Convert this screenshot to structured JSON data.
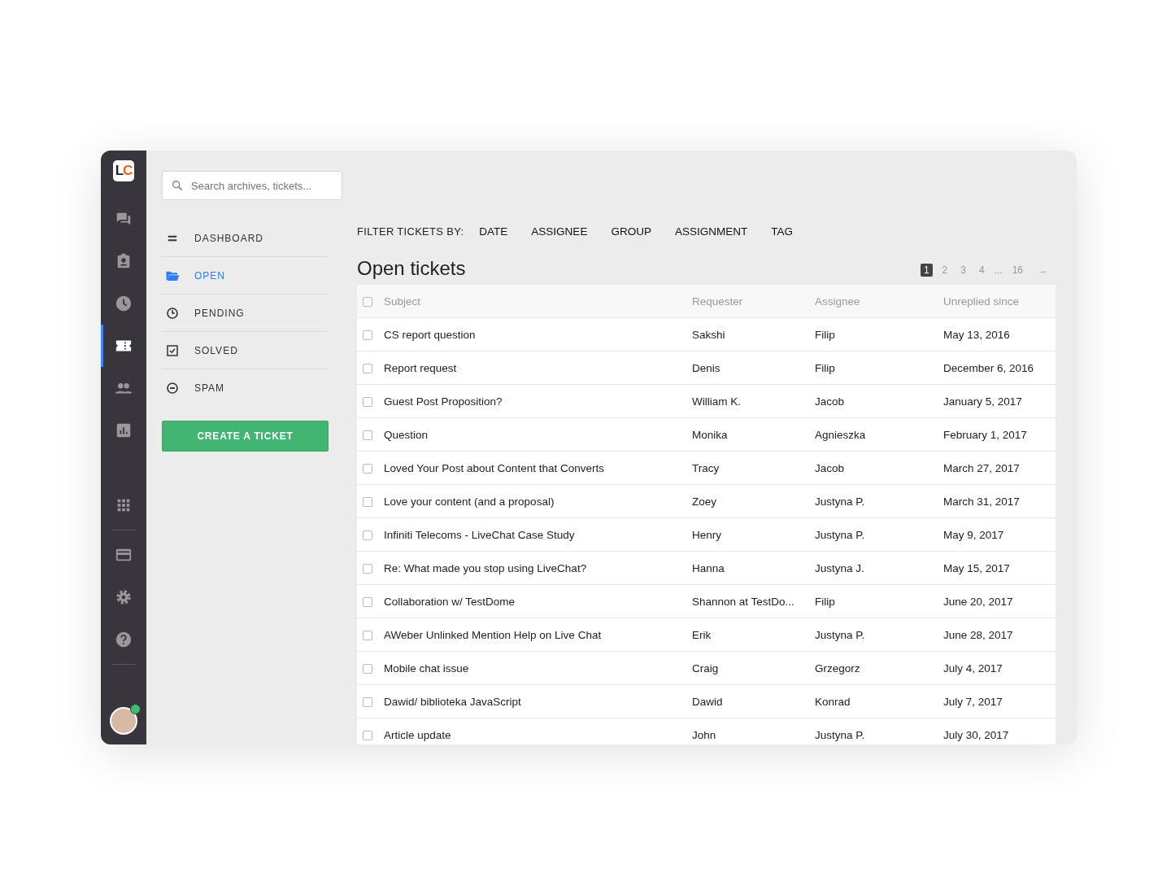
{
  "rail": {
    "top": [
      {
        "selected": false
      },
      {
        "selected": false
      },
      {
        "selected": false
      },
      {
        "selected": true
      },
      {
        "selected": false
      },
      {
        "selected": false
      }
    ],
    "bottom": [
      {
        "selected": false
      },
      {
        "selected": false
      },
      {
        "selected": false
      },
      {
        "selected": false
      }
    ],
    "avatar": {
      "online": true
    }
  },
  "logo": {
    "left": "L",
    "right": "C"
  },
  "search": {
    "placeholder": "Search archives, tickets..."
  },
  "nav": [
    {
      "label": "DASHBOARD",
      "selected": false
    },
    {
      "label": "OPEN",
      "selected": true
    },
    {
      "label": "PENDING",
      "selected": false
    },
    {
      "label": "SOLVED",
      "selected": false
    },
    {
      "label": "SPAM",
      "selected": false
    }
  ],
  "create_button": "CREATE A TICKET",
  "filters": {
    "label": "FILTER TICKETS BY:",
    "options": [
      "DATE",
      "ASSIGNEE",
      "GROUP",
      "ASSIGNMENT",
      "TAG"
    ]
  },
  "title": "Open tickets",
  "pagination": [
    {
      "kind": "page",
      "label": "1",
      "selected": true
    },
    {
      "kind": "page",
      "label": "2",
      "selected": false
    },
    {
      "kind": "page",
      "label": "3",
      "selected": false
    },
    {
      "kind": "page",
      "label": "4",
      "selected": false
    },
    {
      "kind": "gap",
      "label": "..."
    },
    {
      "kind": "page",
      "label": "16",
      "selected": false
    },
    {
      "kind": "next",
      "label": "→"
    }
  ],
  "table": {
    "columns": [
      "Subject",
      "Requester",
      "Assignee",
      "Unreplied since"
    ],
    "header_checked": false,
    "rows": [
      {
        "checked": false,
        "cells": [
          "CS report question",
          "Sakshi",
          "Filip",
          "May 13, 2016"
        ]
      },
      {
        "checked": false,
        "cells": [
          "Report request",
          "Denis",
          "Filip",
          "December 6, 2016"
        ]
      },
      {
        "checked": false,
        "cells": [
          "Guest Post Proposition?",
          "William K.",
          "Jacob",
          "January 5, 2017"
        ]
      },
      {
        "checked": false,
        "cells": [
          "Question",
          "Monika",
          "Agnieszka",
          "February 1, 2017"
        ]
      },
      {
        "checked": false,
        "cells": [
          "Loved Your Post about Content that Converts",
          "Tracy",
          "Jacob",
          "March 27, 2017"
        ]
      },
      {
        "checked": false,
        "cells": [
          "Love your content (and a proposal)",
          "Zoey",
          "Justyna P.",
          "March 31, 2017"
        ]
      },
      {
        "checked": false,
        "cells": [
          "Infiniti Telecoms - LiveChat Case Study",
          "Henry",
          "Justyna P.",
          "May 9, 2017"
        ]
      },
      {
        "checked": false,
        "cells": [
          "Re: What made you stop using LiveChat?",
          "Hanna",
          "Justyna J.",
          "May 15, 2017"
        ]
      },
      {
        "checked": false,
        "cells": [
          "Collaboration w/ TestDome",
          "Shannon at TestDo...",
          "Filip",
          "June 20, 2017"
        ]
      },
      {
        "checked": false,
        "cells": [
          "AWeber Unlinked Mention Help on Live Chat",
          "Erik",
          "Justyna P.",
          "June 28, 2017"
        ]
      },
      {
        "checked": false,
        "cells": [
          "Mobile chat issue",
          "Craig",
          "Grzegorz",
          "July 4, 2017"
        ]
      },
      {
        "checked": false,
        "cells": [
          "Dawid/ biblioteka JavaScript",
          "Dawid",
          "Konrad",
          "July 7, 2017"
        ]
      },
      {
        "checked": false,
        "cells": [
          "Article update",
          "John",
          "Justyna P.",
          "July 30, 2017"
        ]
      }
    ]
  }
}
